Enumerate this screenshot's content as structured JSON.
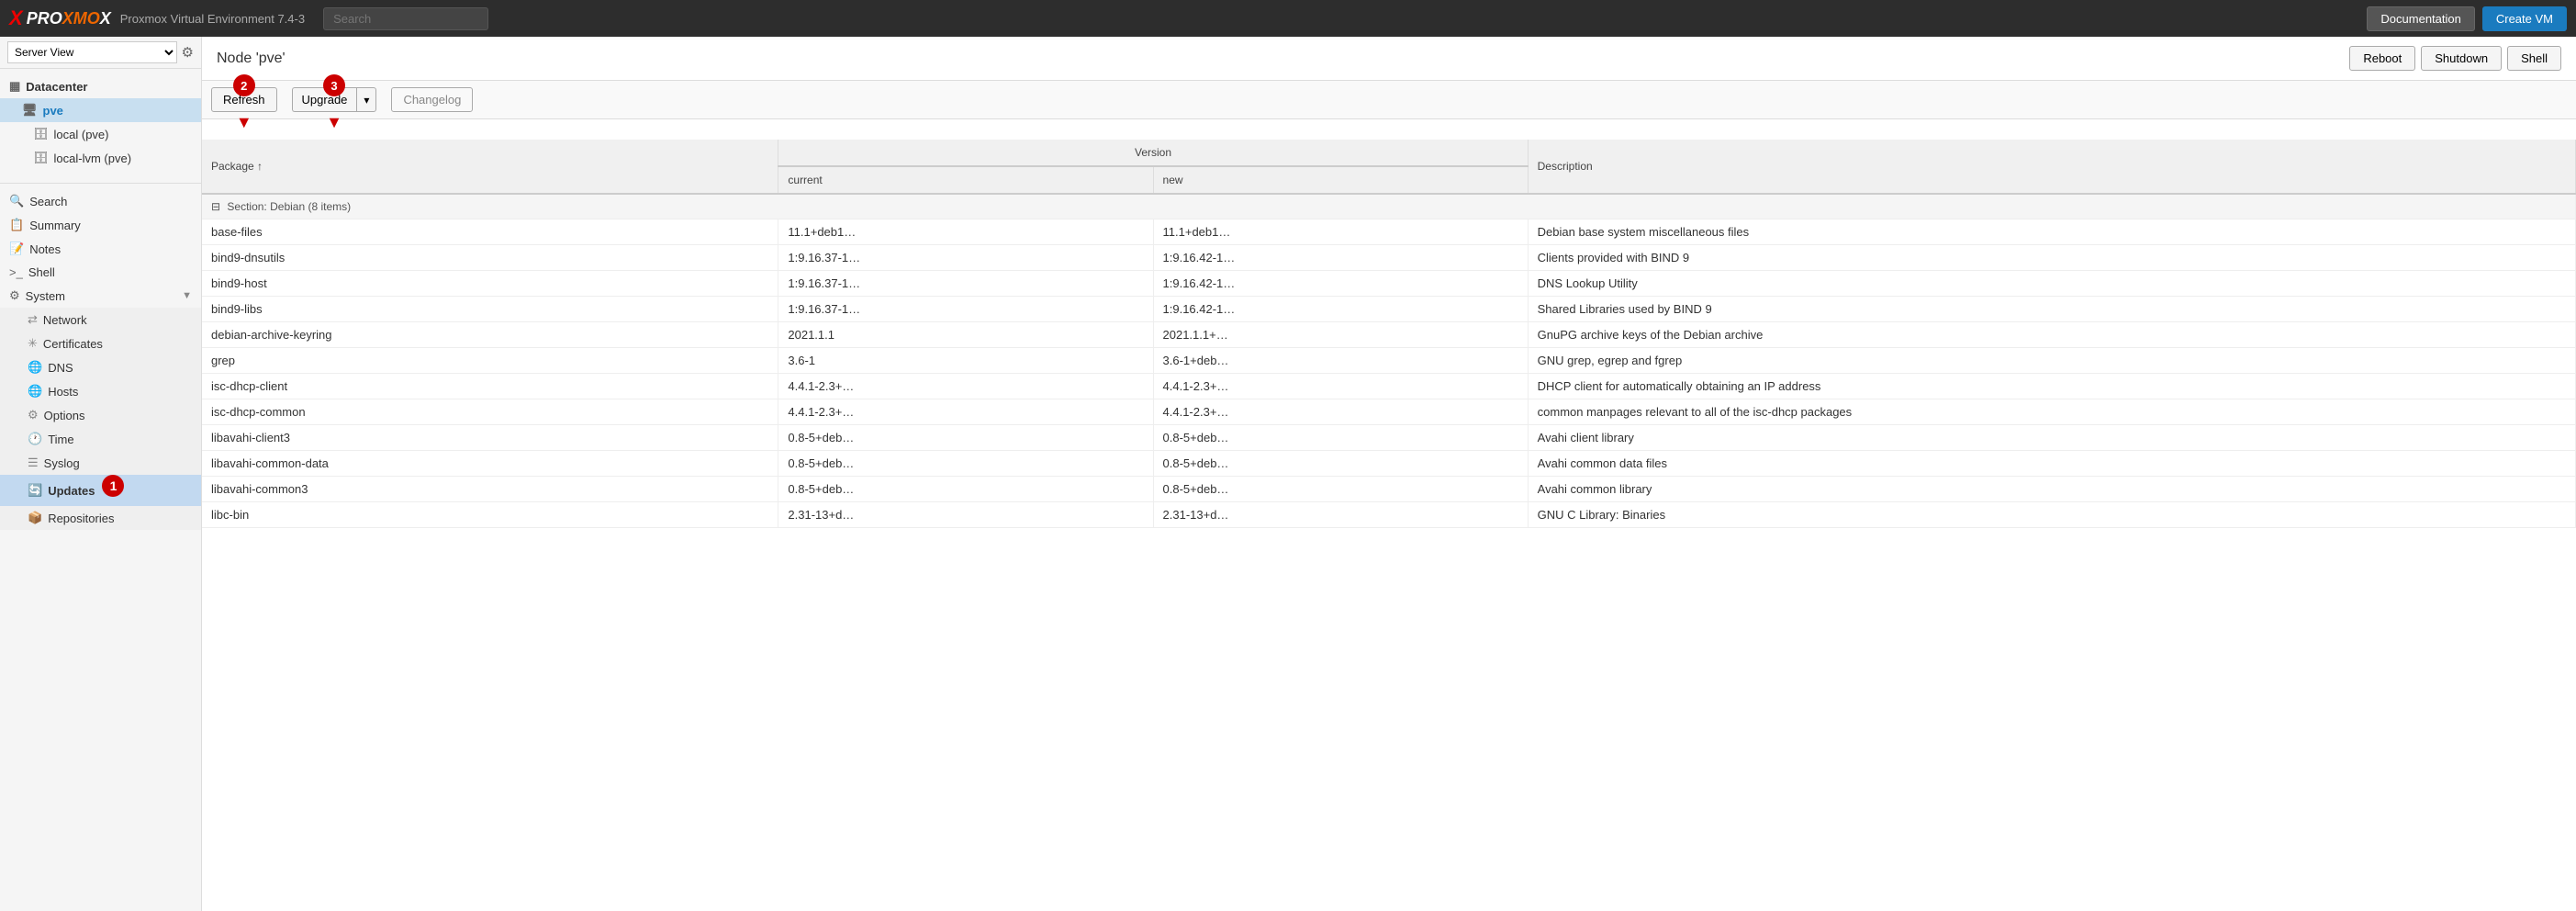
{
  "app": {
    "title": "Proxmox Virtual Environment 7.4-3",
    "logo": {
      "x": "X",
      "prox": "PRO",
      "mox": "XMO",
      "ve": "Virtual Environment 7.4-3"
    }
  },
  "topbar": {
    "search_placeholder": "Search",
    "doc_label": "Documentation",
    "create_vm_label": "Create VM",
    "reboot_label": "Reboot",
    "shutdown_label": "Shutdown",
    "shell_label": "Shell"
  },
  "sidebar": {
    "server_view": "Server View",
    "datacenter_label": "Datacenter",
    "pve_label": "pve",
    "local_label": "local (pve)",
    "local_lvm_label": "local-lvm (pve)"
  },
  "nav": {
    "search": "Search",
    "summary": "Summary",
    "notes": "Notes",
    "shell": "Shell",
    "system": "System",
    "network": "Network",
    "certificates": "Certificates",
    "dns": "DNS",
    "hosts": "Hosts",
    "options": "Options",
    "time": "Time",
    "syslog": "Syslog",
    "updates": "Updates",
    "repositories": "Repositories"
  },
  "content": {
    "title": "Node 'pve'",
    "toolbar": {
      "refresh": "Refresh",
      "upgrade": "Upgrade",
      "changelog": "Changelog"
    },
    "table": {
      "col_package": "Package",
      "col_version": "Version",
      "col_current": "current",
      "col_new": "new",
      "col_description": "Description",
      "group_row": "Section: Debian (8 items)",
      "rows": [
        {
          "package": "base-files",
          "current": "11.1+deb1…",
          "new": "11.1+deb1…",
          "desc": "Debian base system miscellaneous files"
        },
        {
          "package": "bind9-dnsutils",
          "current": "1:9.16.37-1…",
          "new": "1:9.16.42-1…",
          "desc": "Clients provided with BIND 9"
        },
        {
          "package": "bind9-host",
          "current": "1:9.16.37-1…",
          "new": "1:9.16.42-1…",
          "desc": "DNS Lookup Utility"
        },
        {
          "package": "bind9-libs",
          "current": "1:9.16.37-1…",
          "new": "1:9.16.42-1…",
          "desc": "Shared Libraries used by BIND 9"
        },
        {
          "package": "debian-archive-keyring",
          "current": "2021.1.1",
          "new": "2021.1.1+…",
          "desc": "GnuPG archive keys of the Debian archive"
        },
        {
          "package": "grep",
          "current": "3.6-1",
          "new": "3.6-1+deb…",
          "desc": "GNU grep, egrep and fgrep"
        },
        {
          "package": "isc-dhcp-client",
          "current": "4.4.1-2.3+…",
          "new": "4.4.1-2.3+…",
          "desc": "DHCP client for automatically obtaining an IP address"
        },
        {
          "package": "isc-dhcp-common",
          "current": "4.4.1-2.3+…",
          "new": "4.4.1-2.3+…",
          "desc": "common manpages relevant to all of the isc-dhcp packages"
        },
        {
          "package": "libavahi-client3",
          "current": "0.8-5+deb…",
          "new": "0.8-5+deb…",
          "desc": "Avahi client library"
        },
        {
          "package": "libavahi-common-data",
          "current": "0.8-5+deb…",
          "new": "0.8-5+deb…",
          "desc": "Avahi common data files"
        },
        {
          "package": "libavahi-common3",
          "current": "0.8-5+deb…",
          "new": "0.8-5+deb…",
          "desc": "Avahi common library"
        },
        {
          "package": "libc-bin",
          "current": "2.31-13+d…",
          "new": "2.31-13+d…",
          "desc": "GNU C Library: Binaries"
        }
      ]
    }
  },
  "annotations": [
    {
      "id": 1,
      "label": "1"
    },
    {
      "id": 2,
      "label": "2"
    },
    {
      "id": 3,
      "label": "3"
    }
  ]
}
